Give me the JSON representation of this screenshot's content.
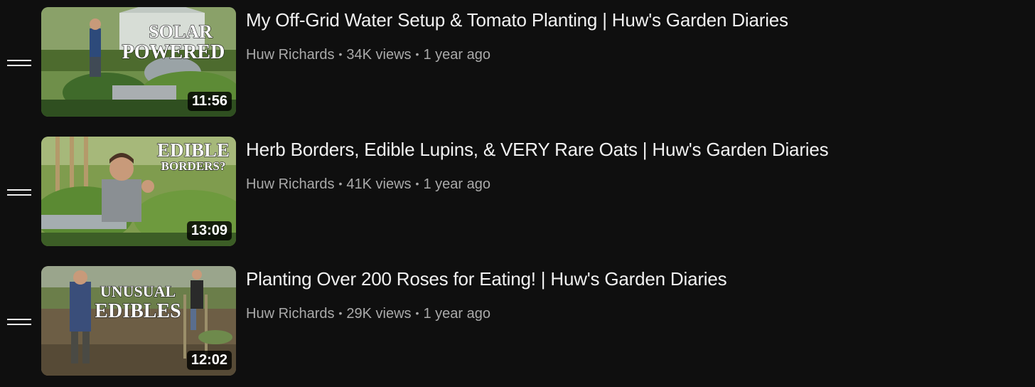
{
  "playlist": {
    "items": [
      {
        "title": "My Off-Grid Water Setup & Tomato Planting | Huw's Garden Diaries",
        "channel": "Huw Richards",
        "views": "34K views",
        "age": "1 year ago",
        "duration": "11:56",
        "overlay_line1": "SOLAR",
        "overlay_line2": "POWERED"
      },
      {
        "title": "Herb Borders, Edible Lupins, & VERY Rare Oats | Huw's Garden Diaries",
        "channel": "Huw Richards",
        "views": "41K views",
        "age": "1 year ago",
        "duration": "13:09",
        "overlay_line1": "EDIBLE",
        "overlay_line2": "BORDERS?"
      },
      {
        "title": "Planting Over 200 Roses for Eating! | Huw's Garden Diaries",
        "channel": "Huw Richards",
        "views": "29K views",
        "age": "1 year ago",
        "duration": "12:02",
        "overlay_line1": "UNUSUAL",
        "overlay_line2": "EDIBLES"
      }
    ],
    "separator": "•",
    "icons": {
      "drag": "drag-handle-icon"
    },
    "colors": {
      "background": "#0f0f0f",
      "title": "#f1f1f1",
      "meta": "#aaaaaa"
    }
  }
}
